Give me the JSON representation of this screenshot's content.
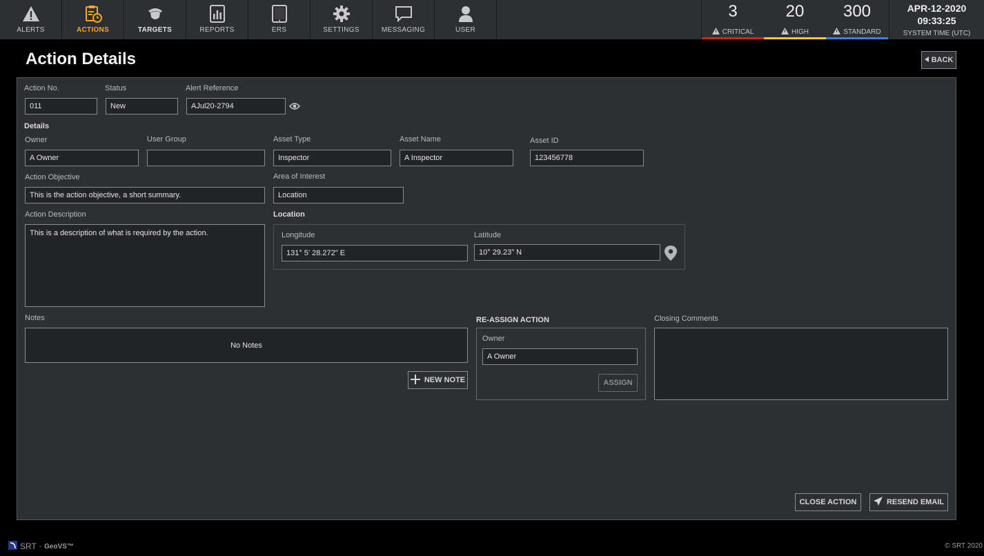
{
  "nav": {
    "items": [
      {
        "label": "ALERTS",
        "icon": "warning-icon"
      },
      {
        "label": "ACTIONS",
        "icon": "clipboard-clock-icon"
      },
      {
        "label": "TARGETS",
        "icon": "target-person-icon"
      },
      {
        "label": "REPORTS",
        "icon": "report-chart-icon"
      },
      {
        "label": "ERS",
        "icon": "tablet-icon"
      },
      {
        "label": "SETTINGS",
        "icon": "gear-icon"
      },
      {
        "label": "MESSAGING",
        "icon": "speech-bubble-icon"
      },
      {
        "label": "USER",
        "icon": "user-icon"
      }
    ],
    "active": "ACTIONS"
  },
  "stats": {
    "critical": {
      "count": "3",
      "label": "CRITICAL",
      "color": "#e0201f"
    },
    "high": {
      "count": "20",
      "label": "HIGH",
      "color": "#f0d020"
    },
    "standard": {
      "count": "300",
      "label": "STANDARD",
      "color": "#3d7fe0"
    }
  },
  "clock": {
    "date": "APR-12-2020",
    "time": "09:33:25",
    "zone": "SYSTEM TIME (UTC)"
  },
  "page": {
    "title": "Action Details",
    "back_label": "BACK"
  },
  "form": {
    "action_no": {
      "label": "Action No.",
      "value": "011"
    },
    "status": {
      "label": "Status",
      "value": "New"
    },
    "alert_reference": {
      "label": "Alert Reference",
      "value": "AJul20-2794"
    },
    "details_heading": "Details",
    "owner": {
      "label": "Owner",
      "value": "A Owner"
    },
    "user_group": {
      "label": "User Group",
      "value": ""
    },
    "asset_type": {
      "label": "Asset Type",
      "value": "Inspector"
    },
    "asset_name": {
      "label": "Asset Name",
      "value": "A Inspector"
    },
    "asset_id": {
      "label": "Asset ID",
      "value": "123456778"
    },
    "action_objective": {
      "label": "Action Objective",
      "value": "This is the action objective, a short summary."
    },
    "area_of_interest": {
      "label": "Area of Interest",
      "value": "Location"
    },
    "action_description": {
      "label": "Action Description",
      "value": "This is a description of what is required by the action."
    },
    "location_heading": "Location",
    "longitude": {
      "label": "Longitude",
      "value": "131° 5' 28.272\" E"
    },
    "latitude": {
      "label": "Latitude",
      "value": "10° 29.23\" N"
    },
    "notes": {
      "label": "Notes",
      "empty_text": "No Notes",
      "new_note_label": "NEW NOTE"
    },
    "reassign": {
      "heading": "RE-ASSIGN ACTION",
      "owner_label": "Owner",
      "owner_value": "A Owner",
      "assign_label": "ASSIGN"
    },
    "closing_comments": {
      "label": "Closing Comments",
      "value": ""
    },
    "close_action_label": "CLOSE ACTION",
    "resend_email_label": "RESEND EMAIL"
  },
  "footer": {
    "brand": "SRT",
    "product": "GeoVS™",
    "copyright": "© SRT 2020"
  },
  "colors": {
    "accent": "#f5a623",
    "panel": "#2d2f33",
    "field": "#232427"
  }
}
